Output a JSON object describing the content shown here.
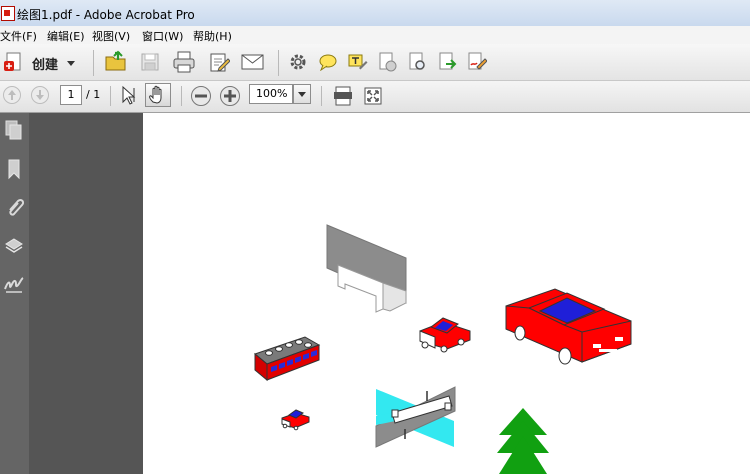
{
  "window": {
    "title": "绘图1.pdf - Adobe Acrobat Pro"
  },
  "menu": {
    "items": [
      "文件(F)",
      "编辑(E)",
      "视图(V)",
      "窗口(W)",
      "帮助(H)"
    ]
  },
  "toolbar": {
    "create_label": "创建"
  },
  "navigation": {
    "current_page": "1",
    "total_pages": "/ 1"
  },
  "zoom": {
    "value": "100%"
  },
  "colors": {
    "car_red": "#ff0000",
    "car_blue": "#1f1fd8",
    "tree_green": "#11a011",
    "water_cyan": "#33e8f0",
    "billboard_gray": "#8c8c8c"
  }
}
